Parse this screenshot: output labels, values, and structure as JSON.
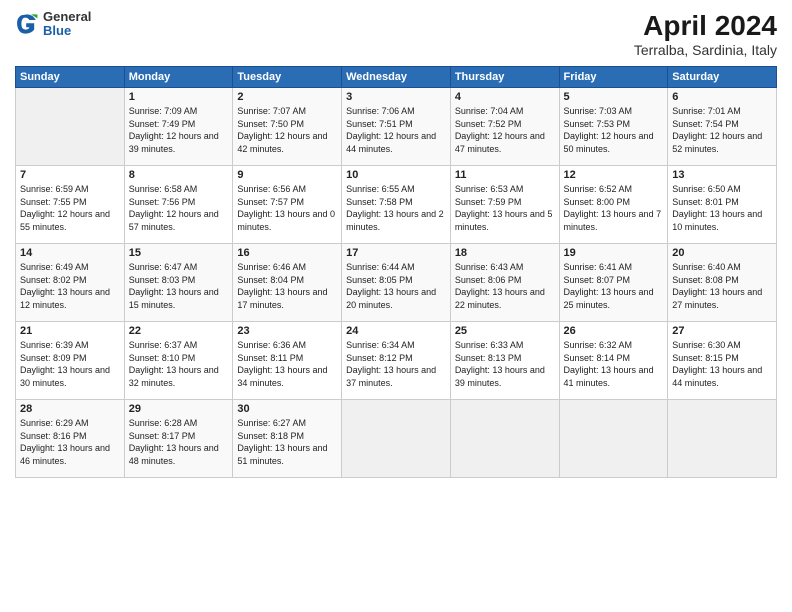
{
  "logo": {
    "general": "General",
    "blue": "Blue"
  },
  "header": {
    "title": "April 2024",
    "subtitle": "Terralba, Sardinia, Italy"
  },
  "weekdays": [
    "Sunday",
    "Monday",
    "Tuesday",
    "Wednesday",
    "Thursday",
    "Friday",
    "Saturday"
  ],
  "weeks": [
    [
      {
        "day": "",
        "empty": true
      },
      {
        "day": "1",
        "sunrise": "Sunrise: 7:09 AM",
        "sunset": "Sunset: 7:49 PM",
        "daylight": "Daylight: 12 hours and 39 minutes."
      },
      {
        "day": "2",
        "sunrise": "Sunrise: 7:07 AM",
        "sunset": "Sunset: 7:50 PM",
        "daylight": "Daylight: 12 hours and 42 minutes."
      },
      {
        "day": "3",
        "sunrise": "Sunrise: 7:06 AM",
        "sunset": "Sunset: 7:51 PM",
        "daylight": "Daylight: 12 hours and 44 minutes."
      },
      {
        "day": "4",
        "sunrise": "Sunrise: 7:04 AM",
        "sunset": "Sunset: 7:52 PM",
        "daylight": "Daylight: 12 hours and 47 minutes."
      },
      {
        "day": "5",
        "sunrise": "Sunrise: 7:03 AM",
        "sunset": "Sunset: 7:53 PM",
        "daylight": "Daylight: 12 hours and 50 minutes."
      },
      {
        "day": "6",
        "sunrise": "Sunrise: 7:01 AM",
        "sunset": "Sunset: 7:54 PM",
        "daylight": "Daylight: 12 hours and 52 minutes."
      }
    ],
    [
      {
        "day": "7",
        "sunrise": "Sunrise: 6:59 AM",
        "sunset": "Sunset: 7:55 PM",
        "daylight": "Daylight: 12 hours and 55 minutes."
      },
      {
        "day": "8",
        "sunrise": "Sunrise: 6:58 AM",
        "sunset": "Sunset: 7:56 PM",
        "daylight": "Daylight: 12 hours and 57 minutes."
      },
      {
        "day": "9",
        "sunrise": "Sunrise: 6:56 AM",
        "sunset": "Sunset: 7:57 PM",
        "daylight": "Daylight: 13 hours and 0 minutes."
      },
      {
        "day": "10",
        "sunrise": "Sunrise: 6:55 AM",
        "sunset": "Sunset: 7:58 PM",
        "daylight": "Daylight: 13 hours and 2 minutes."
      },
      {
        "day": "11",
        "sunrise": "Sunrise: 6:53 AM",
        "sunset": "Sunset: 7:59 PM",
        "daylight": "Daylight: 13 hours and 5 minutes."
      },
      {
        "day": "12",
        "sunrise": "Sunrise: 6:52 AM",
        "sunset": "Sunset: 8:00 PM",
        "daylight": "Daylight: 13 hours and 7 minutes."
      },
      {
        "day": "13",
        "sunrise": "Sunrise: 6:50 AM",
        "sunset": "Sunset: 8:01 PM",
        "daylight": "Daylight: 13 hours and 10 minutes."
      }
    ],
    [
      {
        "day": "14",
        "sunrise": "Sunrise: 6:49 AM",
        "sunset": "Sunset: 8:02 PM",
        "daylight": "Daylight: 13 hours and 12 minutes."
      },
      {
        "day": "15",
        "sunrise": "Sunrise: 6:47 AM",
        "sunset": "Sunset: 8:03 PM",
        "daylight": "Daylight: 13 hours and 15 minutes."
      },
      {
        "day": "16",
        "sunrise": "Sunrise: 6:46 AM",
        "sunset": "Sunset: 8:04 PM",
        "daylight": "Daylight: 13 hours and 17 minutes."
      },
      {
        "day": "17",
        "sunrise": "Sunrise: 6:44 AM",
        "sunset": "Sunset: 8:05 PM",
        "daylight": "Daylight: 13 hours and 20 minutes."
      },
      {
        "day": "18",
        "sunrise": "Sunrise: 6:43 AM",
        "sunset": "Sunset: 8:06 PM",
        "daylight": "Daylight: 13 hours and 22 minutes."
      },
      {
        "day": "19",
        "sunrise": "Sunrise: 6:41 AM",
        "sunset": "Sunset: 8:07 PM",
        "daylight": "Daylight: 13 hours and 25 minutes."
      },
      {
        "day": "20",
        "sunrise": "Sunrise: 6:40 AM",
        "sunset": "Sunset: 8:08 PM",
        "daylight": "Daylight: 13 hours and 27 minutes."
      }
    ],
    [
      {
        "day": "21",
        "sunrise": "Sunrise: 6:39 AM",
        "sunset": "Sunset: 8:09 PM",
        "daylight": "Daylight: 13 hours and 30 minutes."
      },
      {
        "day": "22",
        "sunrise": "Sunrise: 6:37 AM",
        "sunset": "Sunset: 8:10 PM",
        "daylight": "Daylight: 13 hours and 32 minutes."
      },
      {
        "day": "23",
        "sunrise": "Sunrise: 6:36 AM",
        "sunset": "Sunset: 8:11 PM",
        "daylight": "Daylight: 13 hours and 34 minutes."
      },
      {
        "day": "24",
        "sunrise": "Sunrise: 6:34 AM",
        "sunset": "Sunset: 8:12 PM",
        "daylight": "Daylight: 13 hours and 37 minutes."
      },
      {
        "day": "25",
        "sunrise": "Sunrise: 6:33 AM",
        "sunset": "Sunset: 8:13 PM",
        "daylight": "Daylight: 13 hours and 39 minutes."
      },
      {
        "day": "26",
        "sunrise": "Sunrise: 6:32 AM",
        "sunset": "Sunset: 8:14 PM",
        "daylight": "Daylight: 13 hours and 41 minutes."
      },
      {
        "day": "27",
        "sunrise": "Sunrise: 6:30 AM",
        "sunset": "Sunset: 8:15 PM",
        "daylight": "Daylight: 13 hours and 44 minutes."
      }
    ],
    [
      {
        "day": "28",
        "sunrise": "Sunrise: 6:29 AM",
        "sunset": "Sunset: 8:16 PM",
        "daylight": "Daylight: 13 hours and 46 minutes."
      },
      {
        "day": "29",
        "sunrise": "Sunrise: 6:28 AM",
        "sunset": "Sunset: 8:17 PM",
        "daylight": "Daylight: 13 hours and 48 minutes."
      },
      {
        "day": "30",
        "sunrise": "Sunrise: 6:27 AM",
        "sunset": "Sunset: 8:18 PM",
        "daylight": "Daylight: 13 hours and 51 minutes."
      },
      {
        "day": "",
        "empty": true
      },
      {
        "day": "",
        "empty": true
      },
      {
        "day": "",
        "empty": true
      },
      {
        "day": "",
        "empty": true
      }
    ]
  ]
}
